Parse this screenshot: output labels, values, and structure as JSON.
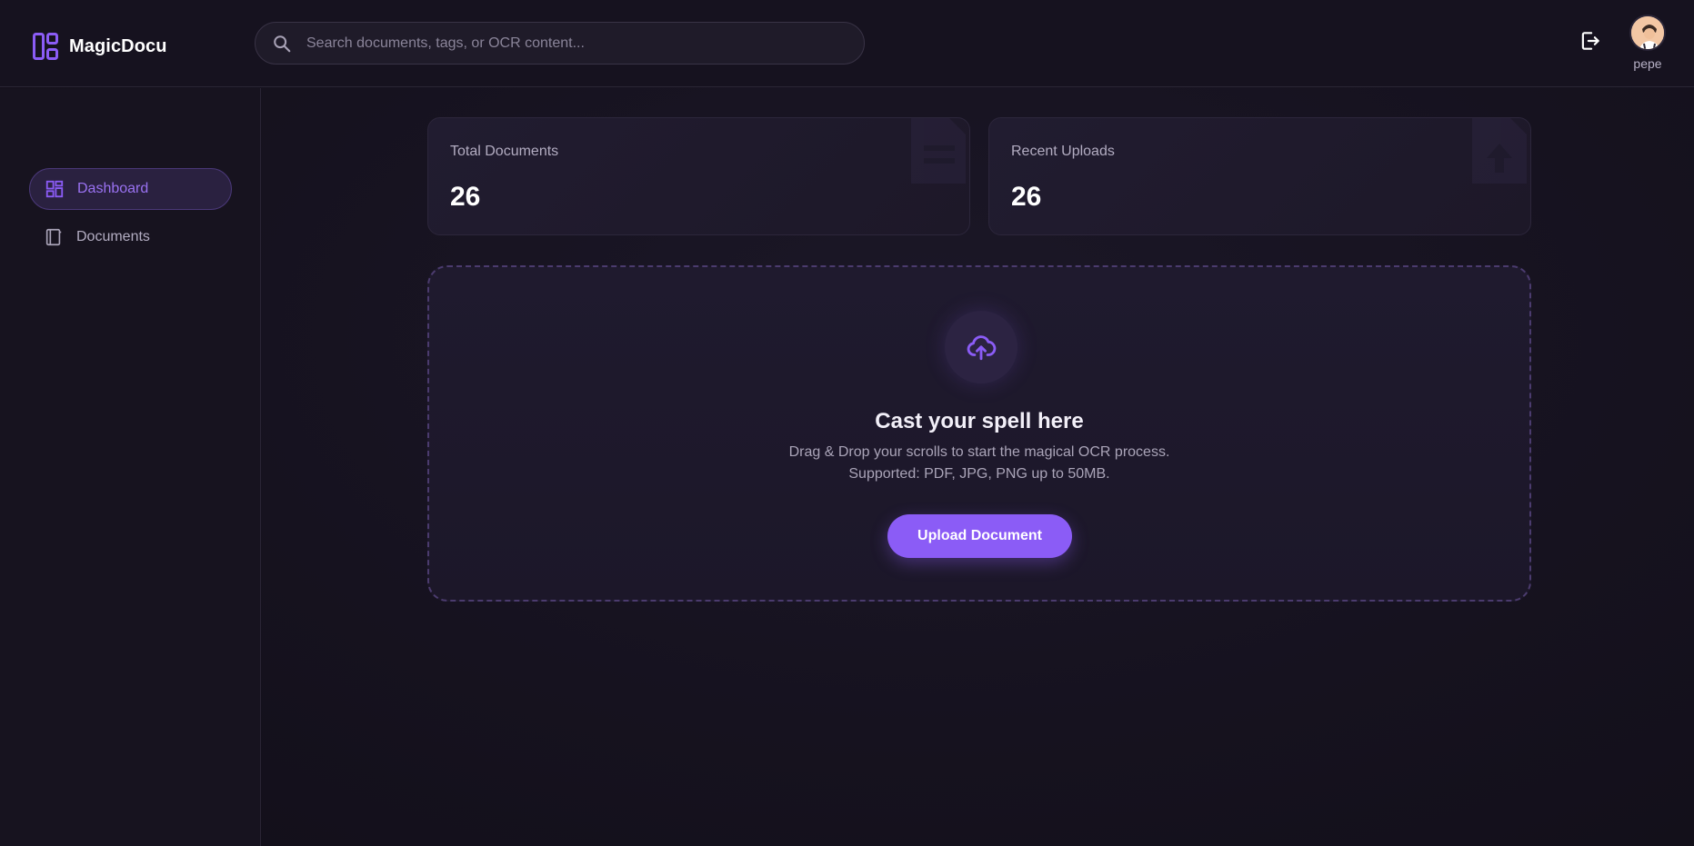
{
  "brand": {
    "name": "MagicDocu",
    "icon": "dashboard-logo-icon"
  },
  "search": {
    "placeholder": "Search documents, tags, or OCR content...",
    "value": ""
  },
  "user": {
    "name": "pepe"
  },
  "sidebar": {
    "items": [
      {
        "label": "Dashboard",
        "icon": "dashboard-icon",
        "active": true
      },
      {
        "label": "Documents",
        "icon": "documents-icon",
        "active": false
      }
    ]
  },
  "stats": [
    {
      "label": "Total Documents",
      "value": "26",
      "icon": "document-icon"
    },
    {
      "label": "Recent Uploads",
      "value": "26",
      "icon": "upload-file-icon"
    }
  ],
  "upload": {
    "title": "Cast your spell here",
    "line1": "Drag & Drop your scrolls to start the magical OCR process.",
    "line2": "Supported: PDF, JPG, PNG up to 50MB.",
    "button_label": "Upload Document"
  },
  "colors": {
    "accent": "#8b5cf6",
    "background": "#15121d",
    "surface": "#1f1a2e"
  }
}
